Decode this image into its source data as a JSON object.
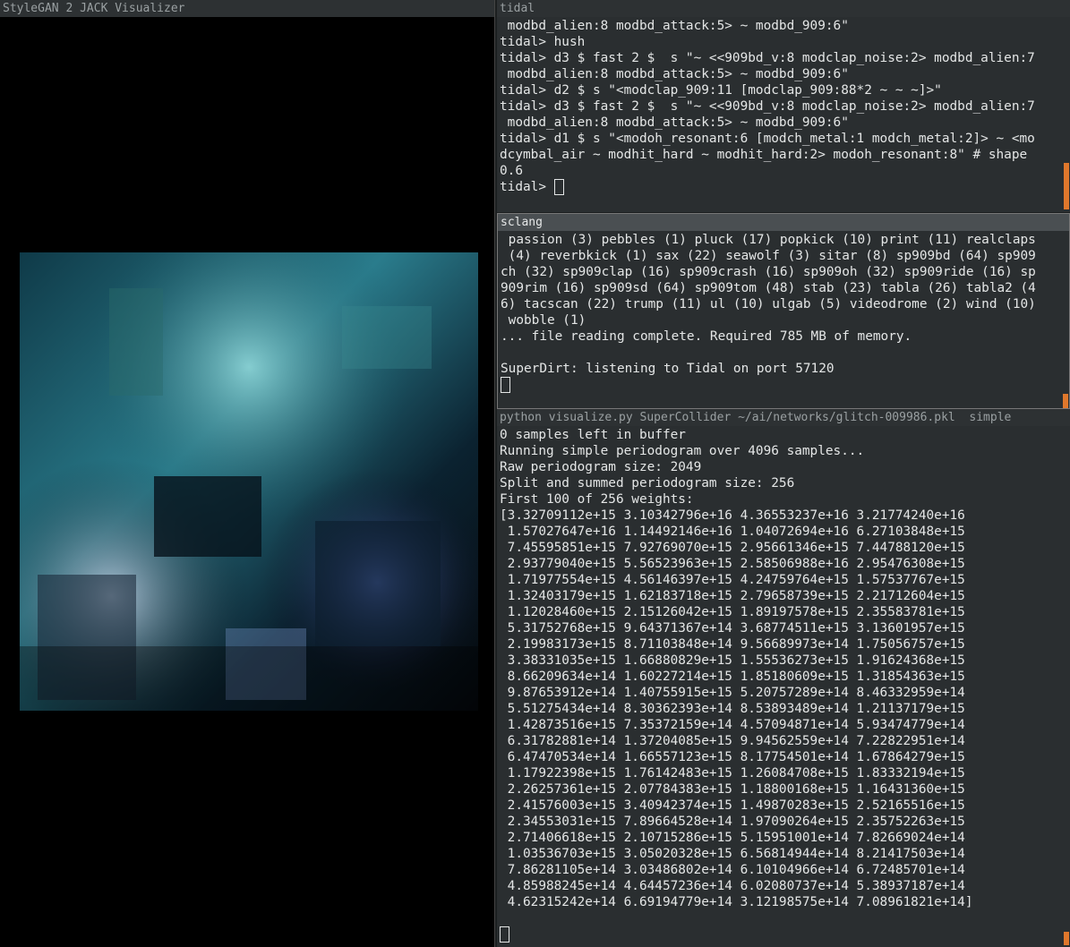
{
  "windows": {
    "visualizer": {
      "title": "StyleGAN 2 JACK Visualizer"
    },
    "tidal": {
      "title": "tidal",
      "lines": [
        " modbd_alien:8 modbd_attack:5> ~ modbd_909:6\"",
        "tidal> hush",
        "tidal> d3 $ fast 2 $  s \"~ <<909bd_v:8 modclap_noise:2> modbd_alien:7",
        " modbd_alien:8 modbd_attack:5> ~ modbd_909:6\"",
        "tidal> d2 $ s \"<modclap_909:11 [modclap_909:88*2 ~ ~ ~]>\"",
        "tidal> d3 $ fast 2 $  s \"~ <<909bd_v:8 modclap_noise:2> modbd_alien:7",
        " modbd_alien:8 modbd_attack:5> ~ modbd_909:6\"",
        "tidal> d1 $ s \"<modoh_resonant:6 [modch_metal:1 modch_metal:2]> ~ <mo",
        "dcymbal_air ~ modhit_hard ~ modhit_hard:2> modoh_resonant:8\" # shape",
        "0.6"
      ],
      "prompt": "tidal> "
    },
    "sclang": {
      "title": "sclang",
      "lines": [
        " passion (3) pebbles (1) pluck (17) popkick (10) print (11) realclaps",
        " (4) reverbkick (1) sax (22) seawolf (3) sitar (8) sp909bd (64) sp909",
        "ch (32) sp909clap (16) sp909crash (16) sp909oh (32) sp909ride (16) sp",
        "909rim (16) sp909sd (64) sp909tom (48) stab (23) tabla (26) tabla2 (4",
        "6) tacscan (22) trump (11) ul (10) ulgab (5) videodrome (2) wind (10)",
        " wobble (1)",
        "... file reading complete. Required 785 MB of memory.",
        "",
        "SuperDirt: listening to Tidal on port 57120"
      ]
    },
    "python": {
      "title": "python visualize.py SuperCollider ~/ai/networks/glitch-009986.pkl  simple",
      "lines": [
        "0 samples left in buffer",
        "Running simple periodogram over 4096 samples...",
        "Raw periodogram size: 2049",
        "Split and summed periodogram size: 256",
        "First 100 of 256 weights:",
        "[3.32709112e+15 3.10342796e+16 4.36553237e+16 3.21774240e+16",
        " 1.57027647e+16 1.14492146e+16 1.04072694e+16 6.27103848e+15",
        " 7.45595851e+15 7.92769070e+15 2.95661346e+15 7.44788120e+15",
        " 2.93779040e+15 5.56523963e+15 2.58506988e+16 2.95476308e+15",
        " 1.71977554e+15 4.56146397e+15 4.24759764e+15 1.57537767e+15",
        " 1.32403179e+15 1.62183718e+15 2.79658739e+15 2.21712604e+15",
        " 1.12028460e+15 2.15126042e+15 1.89197578e+15 2.35583781e+15",
        " 5.31752768e+15 9.64371367e+14 3.68774511e+15 3.13601957e+15",
        " 2.19983173e+15 8.71103848e+14 9.56689973e+14 1.75056757e+15",
        " 3.38331035e+15 1.66880829e+15 1.55536273e+15 1.91624368e+15",
        " 8.66209634e+14 1.60227214e+15 1.85180609e+15 1.31854363e+15",
        " 9.87653912e+14 1.40755915e+15 5.20757289e+14 8.46332959e+14",
        " 5.51275434e+14 8.30362393e+14 8.53893489e+14 1.21137179e+15",
        " 1.42873516e+15 7.35372159e+14 4.57094871e+14 5.93474779e+14",
        " 6.31782881e+14 1.37204085e+15 9.94562559e+14 7.22822951e+14",
        " 6.47470534e+14 1.66557123e+15 8.17754501e+14 1.67864279e+15",
        " 1.17922398e+15 1.76142483e+15 1.26084708e+15 1.83332194e+15",
        " 2.26257361e+15 2.07784383e+15 1.18800168e+15 1.16431360e+15",
        " 2.41576003e+15 3.40942374e+15 1.49870283e+15 2.52165516e+15",
        " 2.34553031e+15 7.89664528e+14 1.97090264e+15 2.35752263e+15",
        " 2.71406618e+15 2.10715286e+15 5.15951001e+14 7.82669024e+14",
        " 1.03536703e+15 3.05020328e+15 6.56814944e+14 8.21417503e+14",
        " 7.86281105e+14 3.03486802e+14 6.10104966e+14 6.72485701e+14",
        " 4.85988245e+14 4.64457236e+14 6.02080737e+14 5.38937187e+14",
        " 4.62315242e+14 6.69194779e+14 3.12198575e+14 7.08961821e+14]"
      ]
    }
  },
  "colors": {
    "scroll_accent": "#e0782c",
    "terminal_bg": "#2a2e30",
    "terminal_fg": "#e4e6e6"
  }
}
